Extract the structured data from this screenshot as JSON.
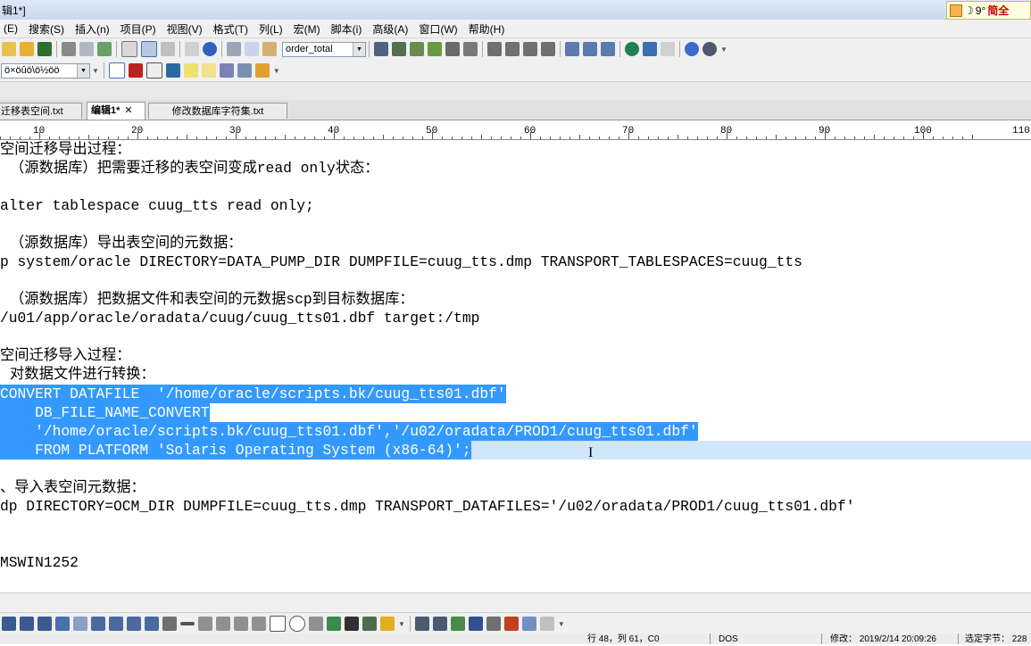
{
  "window": {
    "title": "辑1*]"
  },
  "ime": {
    "moon": "☽",
    "text": "9°",
    "mode": "简全"
  },
  "menu": [
    "(E)",
    "搜索(S)",
    "插入(n)",
    "项目(P)",
    "视图(V)",
    "格式(T)",
    "列(L)",
    "宏(M)",
    "脚本(i)",
    "高级(A)",
    "窗口(W)",
    "帮助(H)"
  ],
  "toolbar": {
    "function_combo": "order_total",
    "encoding_combo": "ö×öûö\\ö½öö"
  },
  "tabs": [
    {
      "label": "迁移表空间.txt",
      "active": false
    },
    {
      "label": "编辑1*",
      "active": true,
      "close": "✕"
    },
    {
      "label": "修改数据库字符集.txt",
      "active": false
    }
  ],
  "ruler": [
    "10",
    "20",
    "30",
    "40",
    "50",
    "60",
    "70",
    "80",
    "90",
    "100",
    "110"
  ],
  "editor": {
    "lines": [
      "空间迁移导出过程：",
      "（源数据库）把需要迁移的表空间变成read only状态：",
      "",
      "alter tablespace cuug_tts read only;",
      "",
      "（源数据库）导出表空间的元数据：",
      "p system/oracle DIRECTORY=DATA_PUMP_DIR DUMPFILE=cuug_tts.dmp TRANSPORT_TABLESPACES=cuug_tts",
      "",
      "（源数据库）把数据文件和表空间的元数据scp到目标数据库：",
      "/u01/app/oracle/oradata/cuug/cuug_tts01.dbf target:/tmp",
      "",
      "空间迁移导入过程：",
      "对数据文件进行转换：",
      "CONVERT DATAFILE  '/home/oracle/scripts.bk/cuug_tts01.dbf'",
      "    DB_FILE_NAME_CONVERT",
      "    '/home/oracle/scripts.bk/cuug_tts01.dbf','/u02/oradata/PROD1/cuug_tts01.dbf'",
      "    FROM PLATFORM 'Solaris Operating System (x86-64)';",
      "",
      "、导入表空间元数据：",
      "dp DIRECTORY=OCM_DIR DUMPFILE=cuug_tts.dmp TRANSPORT_DATAFILES='/u02/oradata/PROD1/cuug_tts01.dbf'",
      "",
      "",
      "MSWIN1252"
    ]
  },
  "status": {
    "position": "行 48，列 61，C0",
    "format": "DOS",
    "modified": "修改： 2019/2/14 20:09:26",
    "selection": "选定字节： 228"
  }
}
